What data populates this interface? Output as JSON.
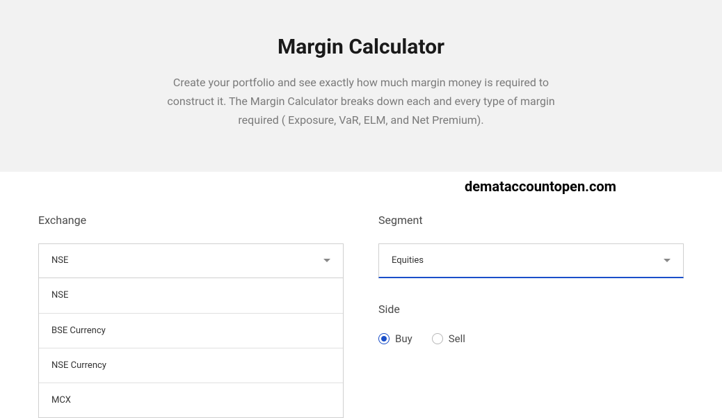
{
  "hero": {
    "title": "Margin Calculator",
    "description": "Create your portfolio and see exactly how much margin money is required to construct it. The Margin Calculator breaks down each and every type of margin required ( Exposure, VaR, ELM, and Net Premium)."
  },
  "watermark": "demataccountopen.com",
  "form": {
    "exchange": {
      "label": "Exchange",
      "selected": "NSE",
      "options": [
        "NSE",
        "BSE Currency",
        "NSE Currency",
        "MCX"
      ]
    },
    "segment": {
      "label": "Segment",
      "selected": "Equities"
    },
    "side": {
      "label": "Side",
      "options": {
        "buy": "Buy",
        "sell": "Sell"
      },
      "selected": "buy"
    }
  }
}
